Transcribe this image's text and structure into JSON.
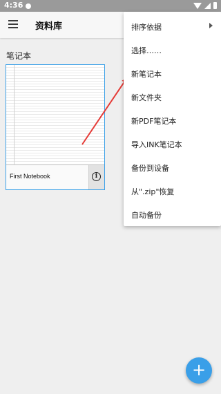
{
  "status_bar": {
    "time": "4:36",
    "icons": [
      "notification-dot-icon",
      "wifi-icon",
      "signal-icon",
      "battery-icon"
    ]
  },
  "toolbar": {
    "title": "资料库",
    "menu_icon": "hamburger-menu-icon"
  },
  "library": {
    "section_heading": "笔记本",
    "notebooks": [
      {
        "name": "First Notebook",
        "info_icon": "info-icon"
      }
    ]
  },
  "overflow_menu": {
    "items": [
      {
        "label": "排序依据",
        "has_submenu": true
      },
      {
        "label": "选择……"
      },
      {
        "label": "新笔记本"
      },
      {
        "label": "新文件夹"
      },
      {
        "label": "新PDF笔记本"
      },
      {
        "label": "导入INK笔记本"
      },
      {
        "label": "备份到设备"
      },
      {
        "label": "从\".zip\"恢复"
      },
      {
        "label": "自动备份"
      }
    ]
  },
  "annotation": {
    "arrow_color": "#e53935"
  },
  "fab": {
    "label": "+",
    "icon": "plus-icon",
    "color": "#3a9fe8"
  }
}
